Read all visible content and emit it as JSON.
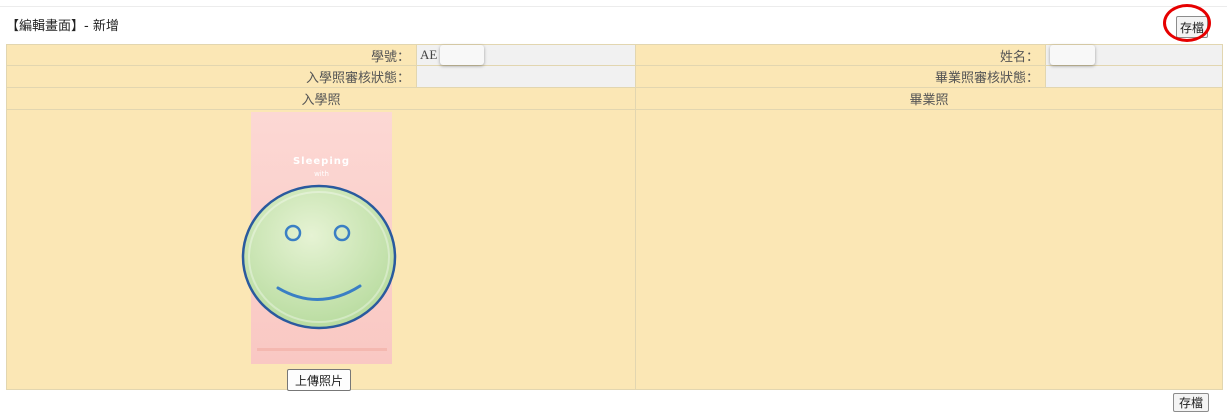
{
  "header": {
    "title": "【編輯畫面】- 新增"
  },
  "toolbar": {
    "save_label": "存檔"
  },
  "footer": {
    "save_label": "存檔"
  },
  "form": {
    "student_id": {
      "label": "學號：",
      "value": "AE"
    },
    "name": {
      "label": "姓名：",
      "value": ""
    },
    "enroll_status": {
      "label": "入學照審核狀態：",
      "value": ""
    },
    "grad_status": {
      "label": "畢業照審核狀態：",
      "value": ""
    }
  },
  "photos": {
    "enroll_header": "入學照",
    "grad_header": "畢業照",
    "upload_label": "上傳照片"
  },
  "poster": {
    "title": "Sleeping",
    "subtitle": "with"
  },
  "colors": {
    "label_bg": "#fbe7b5",
    "value_bg": "#f1f1f1",
    "highlight": "#e60000"
  }
}
